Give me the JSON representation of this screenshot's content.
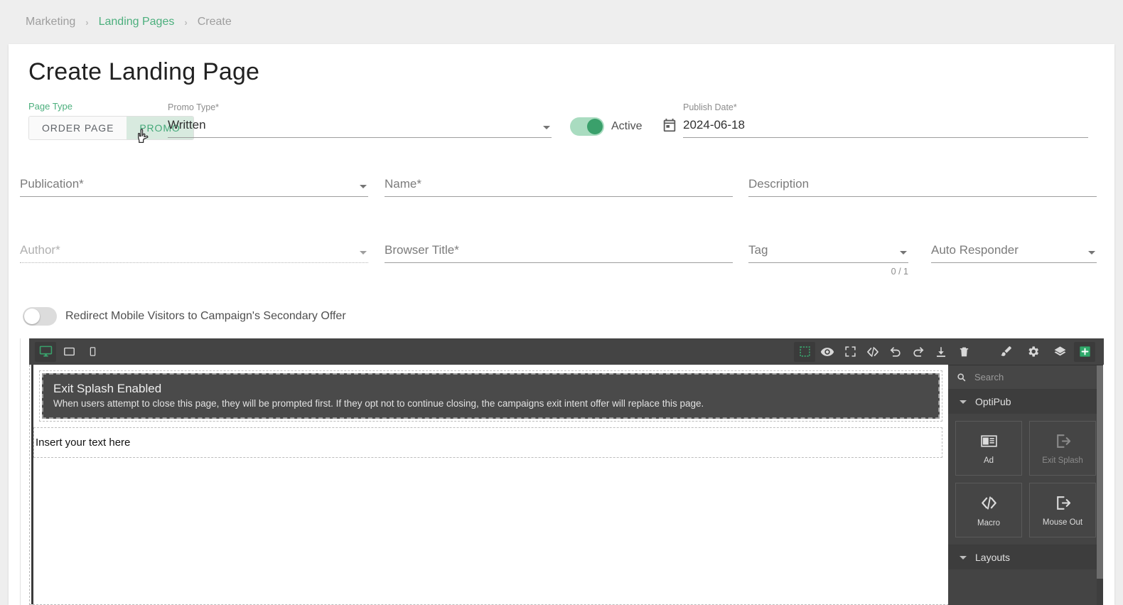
{
  "breadcrumb": {
    "items": [
      {
        "label": "Marketing",
        "active": false
      },
      {
        "label": "Landing Pages",
        "active": true
      },
      {
        "label": "Create",
        "active": false
      }
    ],
    "separator": "›"
  },
  "page": {
    "title": "Create Landing Page"
  },
  "page_type": {
    "label": "Page Type",
    "options": [
      "ORDER PAGE",
      "PROMO"
    ],
    "selected": "PROMO"
  },
  "form": {
    "promo_type": {
      "label": "Promo Type*",
      "value": "Written"
    },
    "active_switch": {
      "label": "Active",
      "state": "on"
    },
    "publish_date": {
      "label": "Publish Date*",
      "value": "2024-06-18",
      "icon": "calendar-icon"
    },
    "publication": {
      "label": "Publication*",
      "value": ""
    },
    "name": {
      "label": "Name*",
      "value": ""
    },
    "description": {
      "label": "Description",
      "value": ""
    },
    "author": {
      "label": "Author*",
      "value": "",
      "disabled": true
    },
    "browser_title": {
      "label": "Browser Title*",
      "value": ""
    },
    "tag": {
      "label": "Tag",
      "value": "",
      "counter": "0 / 1"
    },
    "auto_responder": {
      "label": "Auto Responder",
      "value": ""
    },
    "redirect_switch": {
      "label": "Redirect Mobile Visitors to Campaign's Secondary Offer",
      "state": "off"
    }
  },
  "editor": {
    "device_buttons": [
      {
        "name": "desktop-icon",
        "active": true
      },
      {
        "name": "tablet-icon",
        "active": false
      },
      {
        "name": "mobile-icon",
        "active": false
      }
    ],
    "tools": [
      {
        "name": "borders-icon",
        "active": true
      },
      {
        "name": "preview-eye-icon",
        "active": false
      },
      {
        "name": "fullscreen-icon",
        "active": false
      },
      {
        "name": "code-icon",
        "active": false
      },
      {
        "name": "undo-icon",
        "active": false
      },
      {
        "name": "redo-icon",
        "active": false
      },
      {
        "name": "import-icon",
        "active": false
      },
      {
        "name": "trash-icon",
        "active": false
      }
    ],
    "manager_tools": [
      {
        "name": "paint-brush-icon",
        "active": false
      },
      {
        "name": "gear-icon",
        "active": false
      },
      {
        "name": "layers-icon",
        "active": false
      },
      {
        "name": "add-blocks-icon",
        "active": true
      }
    ],
    "canvas": {
      "splash": {
        "title": "Exit Splash Enabled",
        "description": "When users attempt to close this page, they will be prompted first. If they opt not to continue closing, the campaigns exit intent offer will replace this page."
      },
      "text_block": "Insert your text here"
    }
  },
  "blocks_panel": {
    "search": {
      "placeholder": "Search",
      "value": ""
    },
    "categories": [
      {
        "label": "OptiPub",
        "expanded": true,
        "blocks": [
          {
            "label": "Ad",
            "icon": "ad-icon",
            "disabled": false
          },
          {
            "label": "Exit Splash",
            "icon": "exit-icon",
            "disabled": true
          },
          {
            "label": "Macro",
            "icon": "code-icon",
            "disabled": false
          },
          {
            "label": "Mouse Out",
            "icon": "exit-icon",
            "disabled": false
          }
        ]
      },
      {
        "label": "Layouts",
        "expanded": true,
        "blocks": []
      }
    ]
  },
  "colors": {
    "accent_green": "#4caf7d",
    "toggle_active_bg": "#d8eadf",
    "toolbar_bg": "#444444",
    "panel_bg": "#444444",
    "page_bg": "#eeeeee"
  }
}
